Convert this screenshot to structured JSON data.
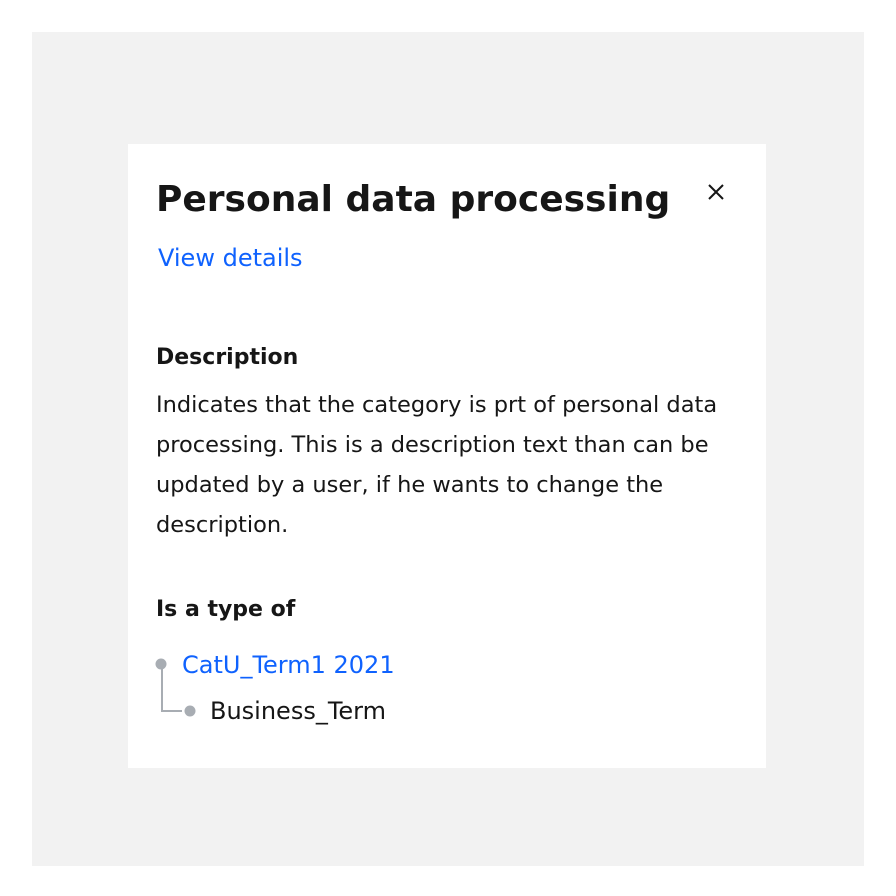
{
  "panel": {
    "title": "Personal data processing",
    "view_details_label": "View details",
    "close_icon": "close-icon"
  },
  "description": {
    "heading": "Description",
    "text": "Indicates that the category is prt of personal data processing. This is a description text than can be updated by a user, if he wants to change the description."
  },
  "type_of": {
    "heading": "Is a type of",
    "parent_label": "CatU_Term1 2021",
    "child_label": "Business_Term"
  },
  "colors": {
    "link": "#0f62fe",
    "text": "#161616",
    "backdrop": "#f2f2f2",
    "tree_line": "#a8adb3"
  }
}
